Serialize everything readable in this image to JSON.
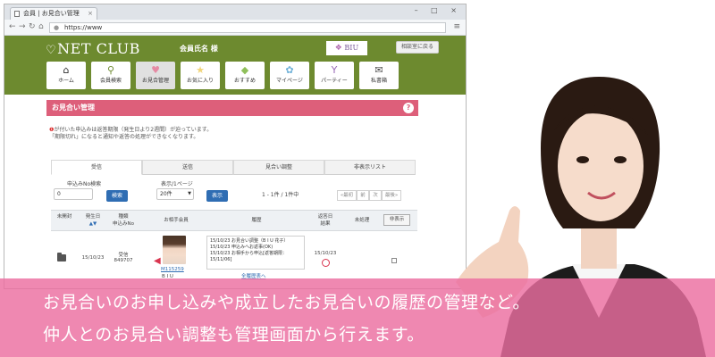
{
  "browser": {
    "tab_title": "会員 | お見合い管理",
    "tab_close": "×",
    "window_controls": "– □ ×",
    "url": "https://www",
    "menu": "≡"
  },
  "header": {
    "logo": "NET CLUB",
    "member_name": "会員氏名 様",
    "brand": "BIU",
    "consult_button": "相談室に戻る",
    "nav": [
      {
        "label": "ホーム",
        "icon": "home-icon",
        "glyph": "⌂",
        "color": "#2c2c2c"
      },
      {
        "label": "会員検索",
        "icon": "search-icon",
        "glyph": "⚲",
        "color": "#6d8a2f"
      },
      {
        "label": "お見合管理",
        "icon": "heart-icon",
        "glyph": "♥",
        "color": "#e58aa3"
      },
      {
        "label": "お気に入り",
        "icon": "star-icon",
        "glyph": "★",
        "color": "#f1d57a"
      },
      {
        "label": "おすすめ",
        "icon": "tag-icon",
        "glyph": "◆",
        "color": "#8fbf5a"
      },
      {
        "label": "マイページ",
        "icon": "gear-icon",
        "glyph": "✿",
        "color": "#6fb1d8"
      },
      {
        "label": "パーティー",
        "icon": "glass-icon",
        "glyph": "Y",
        "color": "#9a6ab8"
      },
      {
        "label": "私書箱",
        "icon": "mail-icon",
        "glyph": "✉",
        "color": "#4a4a4a"
      }
    ]
  },
  "section": {
    "title": "お見合い管理",
    "help": "?",
    "notice_line1": "が付いた申込みは返答期限（発生日より2週間）が迫っています。",
    "notice_line2": "「期限切れ」になると通知や返答の処理ができなくなります。",
    "notice_mark": "❶"
  },
  "tabs": [
    "受信",
    "送信",
    "見合い調整",
    "非表示リスト"
  ],
  "search": {
    "label": "申込みNo検索",
    "value": "0",
    "button": "検索",
    "display_label": "表示/1ページ",
    "display_value": "20件",
    "display_button": "表示",
    "result": "1 - 1件 / 1件中"
  },
  "pager": [
    "«最初",
    "前",
    "次",
    "最後»"
  ],
  "table": {
    "headers": [
      "未開封",
      "発生日",
      "種類\n申込みNo",
      "お相手会員",
      "履歴",
      "返答日\n結果",
      "未処理"
    ],
    "sort_glyph": "▲▼",
    "unhide_button": "非表示",
    "rows": [
      {
        "date": "15/10/23",
        "kind": "受信",
        "apply_no": "849707",
        "member_id": "M115259",
        "company": "B I U",
        "history": [
          "15/10/23 お見合い調整（B I U 花子）",
          "15/10/23 申込みへお返事(OK)",
          "15/10/23 お相手から申込[返答期限：15/11/06]"
        ],
        "history_link": "全履歴表へ",
        "reply_date": "15/10/23"
      }
    ]
  },
  "banner": {
    "line1": "お見合いのお申し込みや成立したお見合いの履歴の管理など。",
    "line2": "仲人とのお見合い調整も管理画面から行えます。"
  }
}
